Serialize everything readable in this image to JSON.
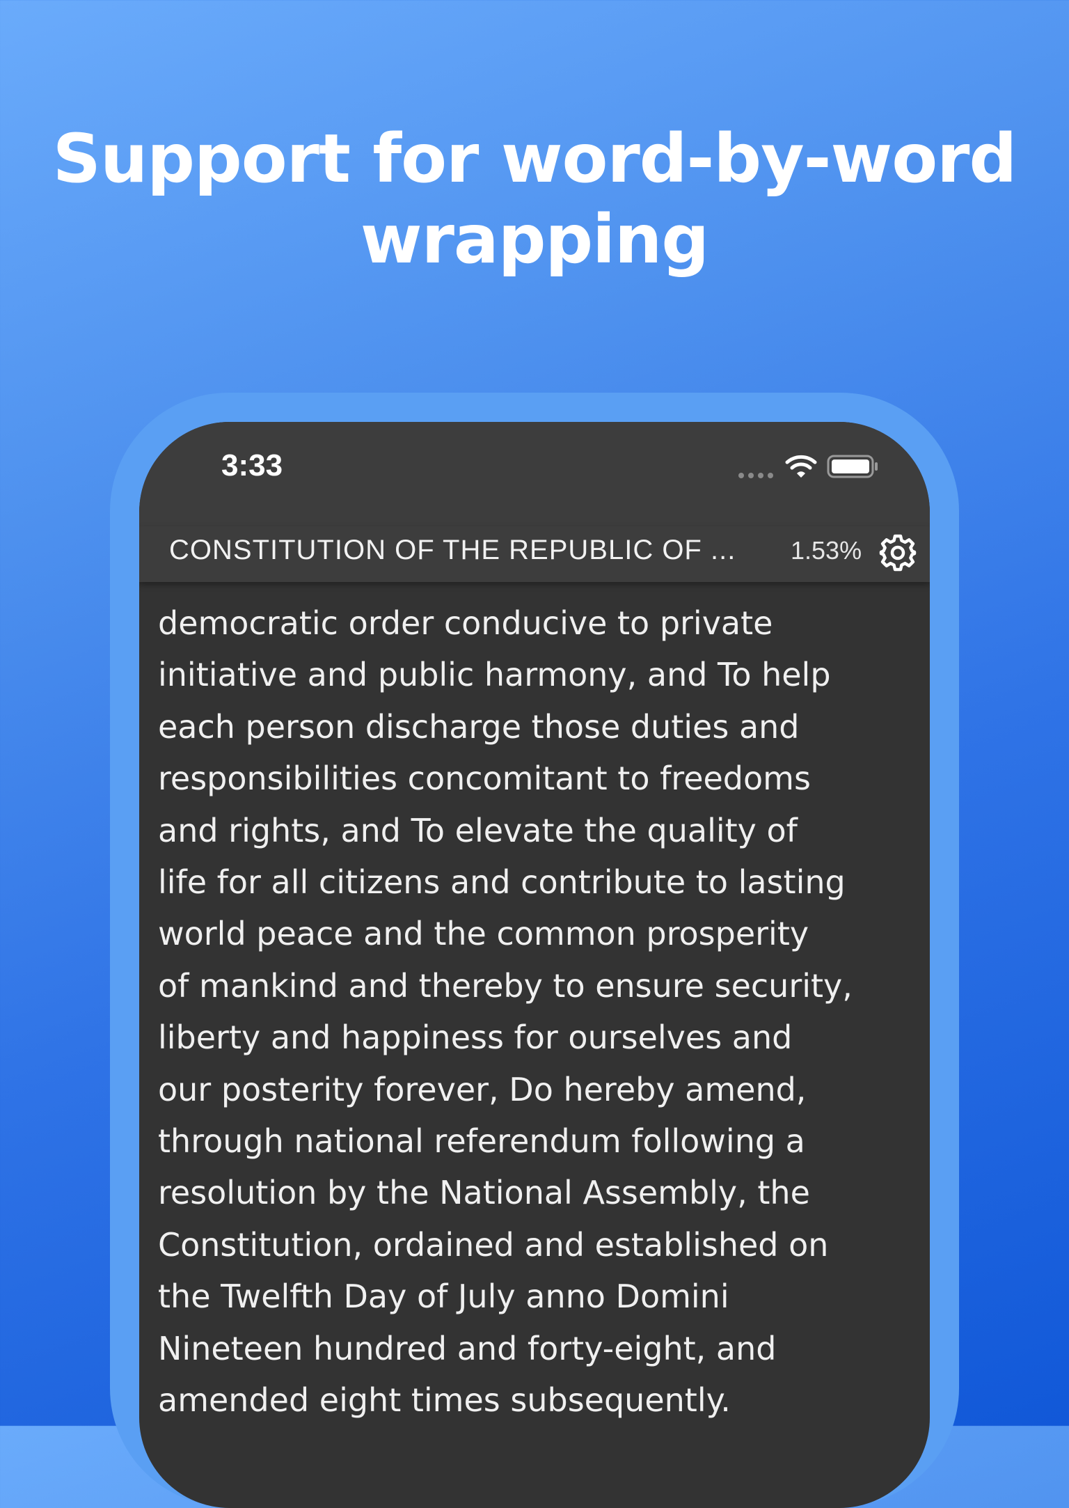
{
  "headline": {
    "lines": [
      "Support for word-by-word",
      "wrapping"
    ]
  },
  "status_bar": {
    "time": "3:33"
  },
  "nav_bar": {
    "title": "CONSTITUTION OF THE REPUBLIC OF ...",
    "progress": "1.53%"
  },
  "reader": {
    "lines": [
      "democratic order conducive to private",
      "initiative and public harmony, and To help",
      "each person discharge those duties and",
      "responsibilities concomitant to freedoms",
      "and rights, and To elevate the quality of",
      "life for all citizens and contribute to lasting",
      "world peace and the common prosperity",
      "of mankind and thereby to ensure security,",
      "liberty and happiness for ourselves and",
      "our posterity forever, Do hereby amend,",
      "through national referendum following a",
      "resolution by the National Assembly, the",
      "Constitution, ordained and established on",
      "the Twelfth Day of July anno Domini",
      "Nineteen hundred and forty-eight, and",
      "amended eight times subsequently."
    ]
  },
  "icons": [
    "signal-icon",
    "wifi-icon",
    "battery-icon",
    "gear-icon"
  ],
  "colors": {
    "background_top": "#6aabfb",
    "background_bottom": "#1158d8",
    "frame": "#5a9ff3",
    "screen": "#333333",
    "bar": "#3d3d3d",
    "text": "#f0f0f0"
  }
}
